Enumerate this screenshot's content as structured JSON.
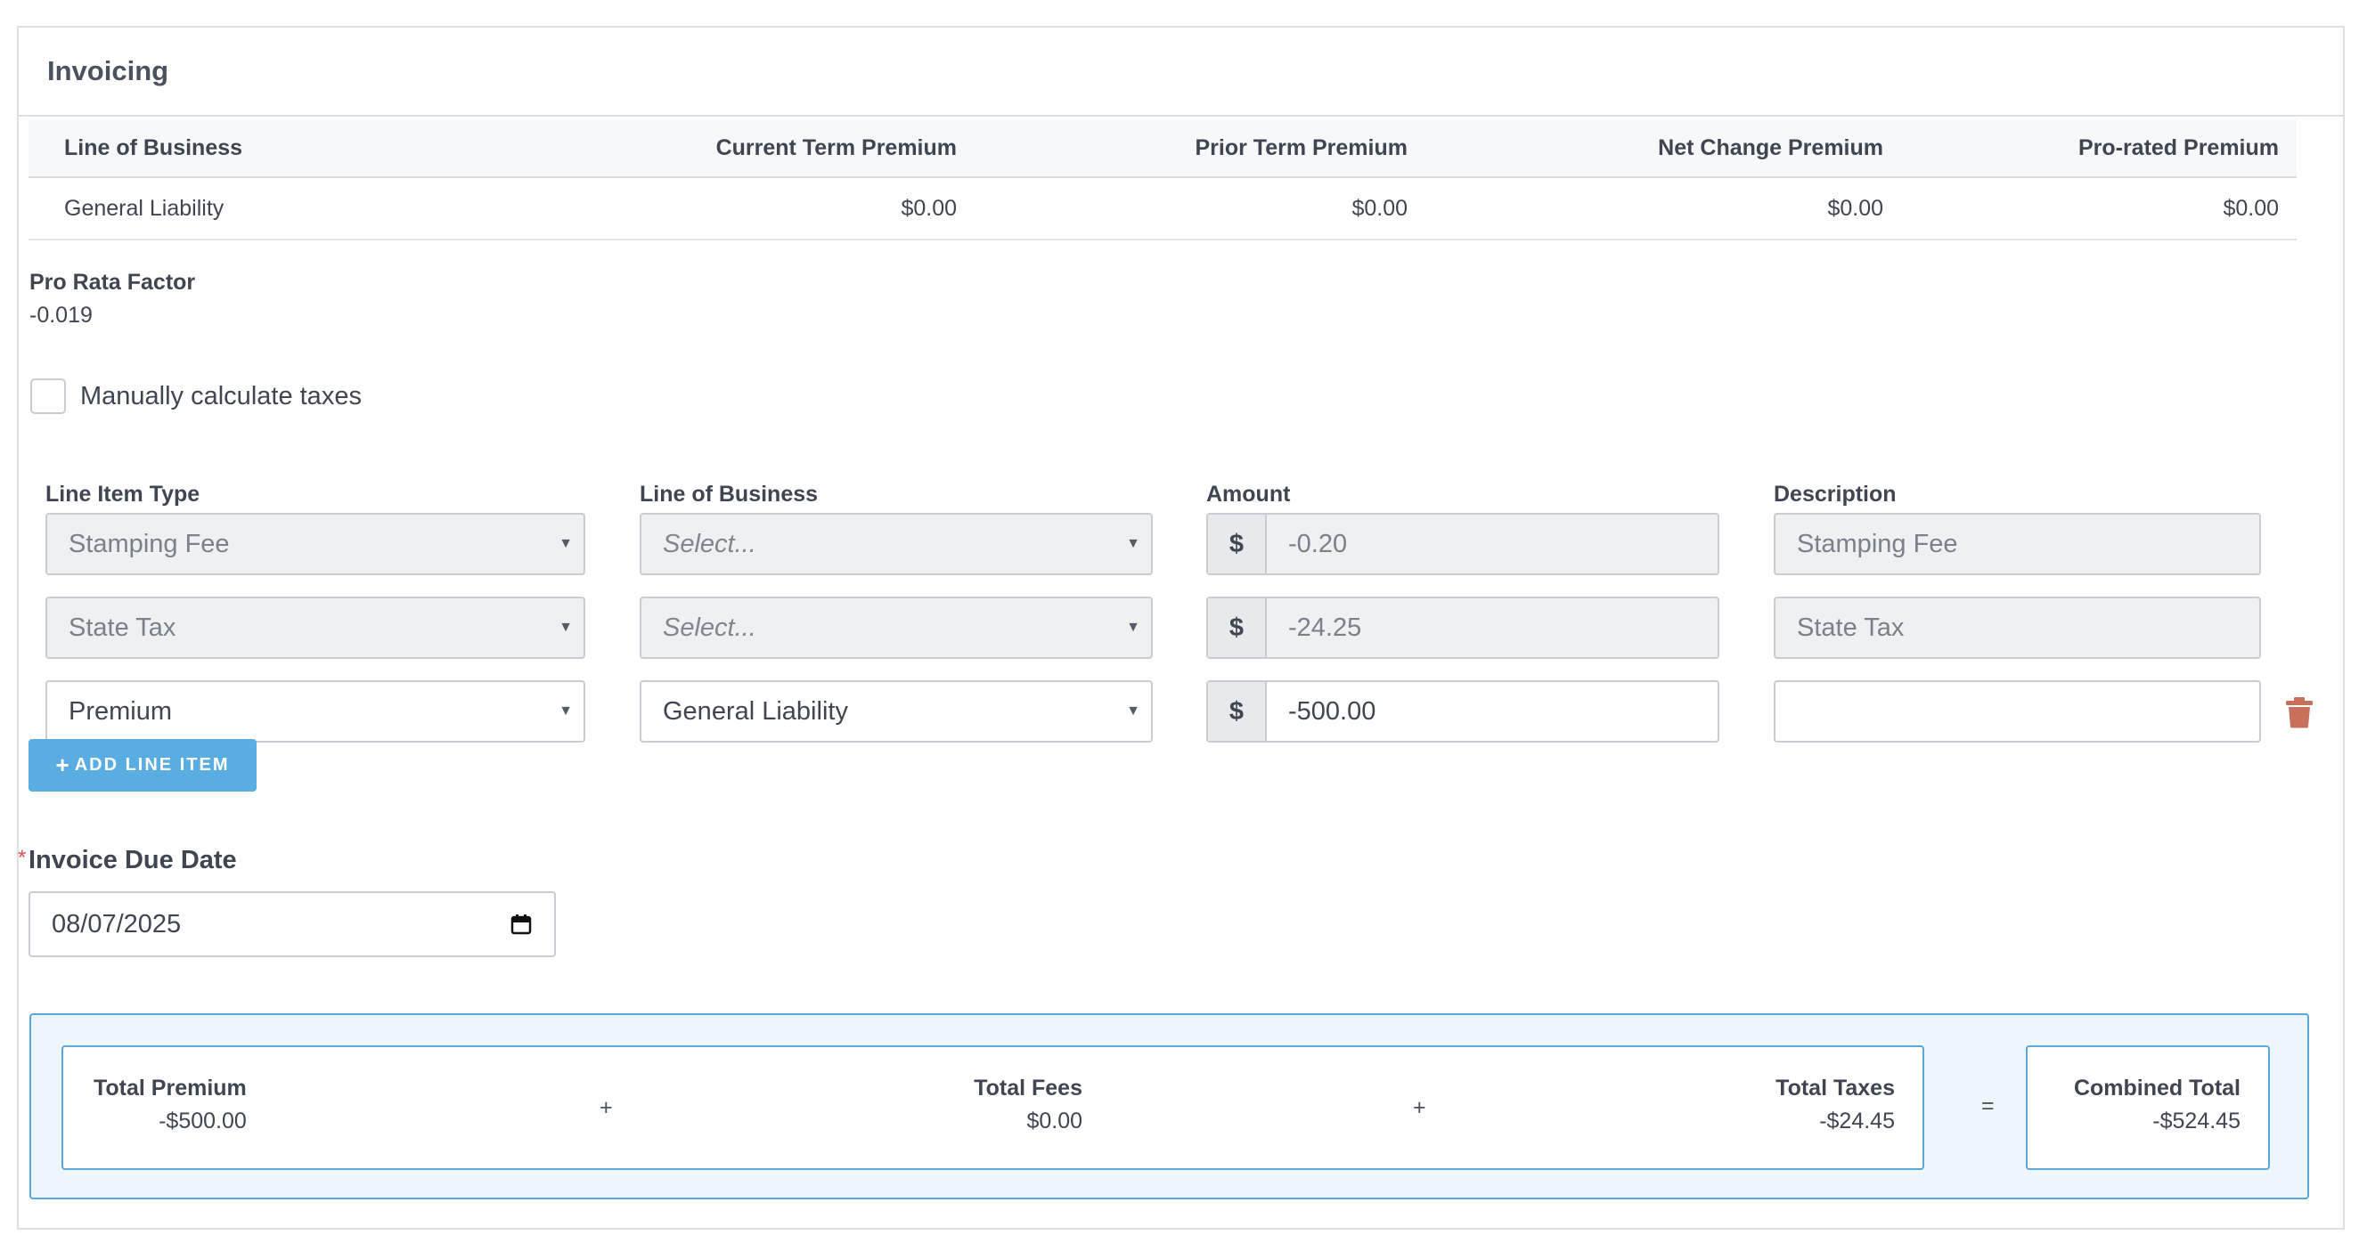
{
  "section": {
    "title": "Invoicing"
  },
  "premium_table": {
    "headers": [
      "Line of Business",
      "Current Term Premium",
      "Prior Term Premium",
      "Net Change Premium",
      "Pro-rated Premium"
    ],
    "rows": [
      [
        "General Liability",
        "$0.00",
        "$0.00",
        "$0.00",
        "$0.00"
      ]
    ]
  },
  "pro_rata": {
    "label": "Pro Rata Factor",
    "value": "-0.019"
  },
  "manual_tax": {
    "label": "Manually calculate taxes",
    "checked": false
  },
  "line_items": {
    "headers": {
      "type": "Line Item Type",
      "lob": "Line of Business",
      "amount": "Amount",
      "description": "Description"
    },
    "currency_symbol": "$",
    "rows": [
      {
        "type": "Stamping Fee",
        "lob": "Select...",
        "amount": "-0.20",
        "description": "Stamping Fee",
        "disabled": true
      },
      {
        "type": "State Tax",
        "lob": "Select...",
        "amount": "-24.25",
        "description": "State Tax",
        "disabled": true
      },
      {
        "type": "Premium",
        "lob": "General Liability",
        "amount": "-500.00",
        "description": "",
        "disabled": false
      }
    ],
    "add_label": "ADD LINE ITEM"
  },
  "due_date": {
    "label": "Invoice Due Date",
    "required_mark": "*",
    "value": "08/07/2025"
  },
  "totals": {
    "premium_label": "Total Premium",
    "premium_value": "-$500.00",
    "fees_label": "Total Fees",
    "fees_value": "$0.00",
    "taxes_label": "Total Taxes",
    "taxes_value": "-$24.45",
    "combined_label": "Combined Total",
    "combined_value": "-$524.45",
    "plus": "+",
    "equals": "="
  },
  "colors": {
    "accent": "#5aade0",
    "border_accent": "#5aa7d9",
    "danger": "#c9705c"
  }
}
